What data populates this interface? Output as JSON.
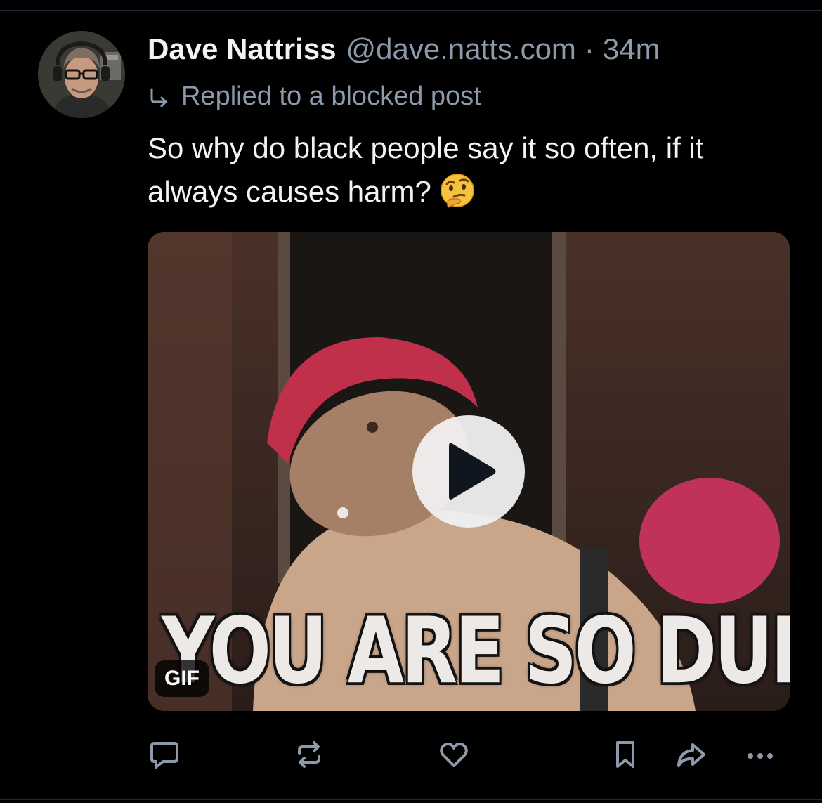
{
  "post": {
    "author_name": "Dave Nattriss",
    "author_handle": "@dave.natts.com",
    "separator": "·",
    "timestamp": "34m",
    "reply_context": "Replied to a blocked post",
    "text": "So why do black people say it so often, if it always causes harm?",
    "emoji": "thinking-face-emoji"
  },
  "media": {
    "gif_caption": "YOU ARE SO DUMB.",
    "badge": "GIF",
    "play_icon": "play-icon"
  },
  "actions": {
    "reply_icon": "comment-icon",
    "repost_icon": "repost-icon",
    "like_icon": "heart-icon",
    "bookmark_icon": "bookmark-icon",
    "share_icon": "share-icon",
    "more_icon": "more-icon"
  },
  "colors": {
    "background": "#000000",
    "text_primary": "#f1f3f5",
    "text_secondary": "#8d9aab",
    "icon": "#8d9aab"
  }
}
